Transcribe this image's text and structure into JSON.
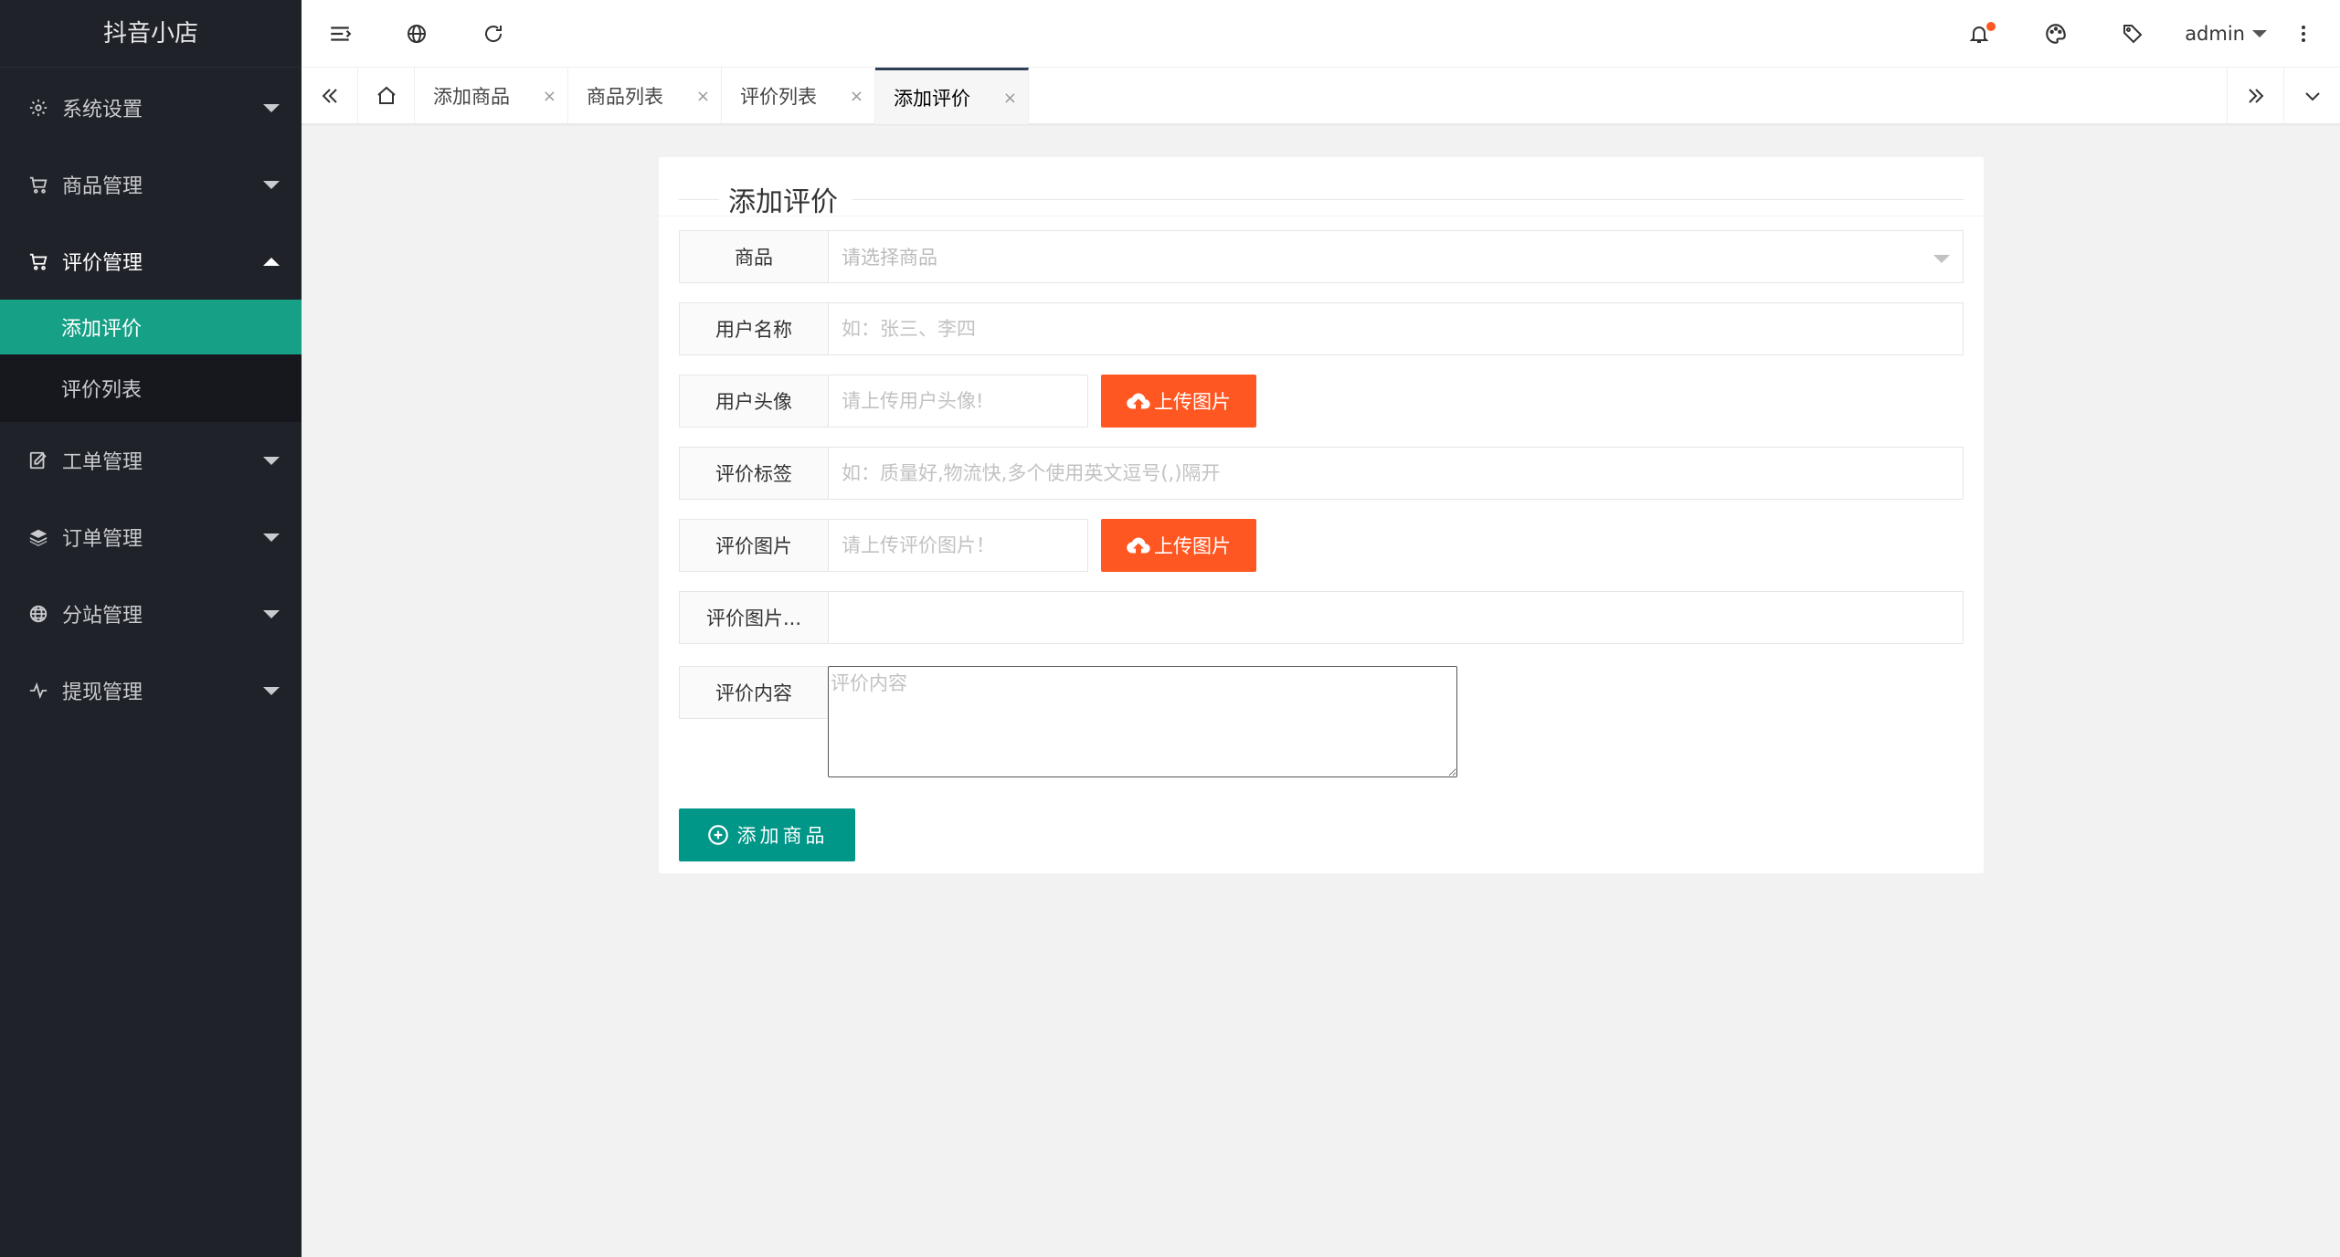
{
  "app": {
    "title": "抖音小店"
  },
  "sidebar": {
    "items": [
      {
        "label": "系统设置",
        "icon": "gear-icon"
      },
      {
        "label": "商品管理",
        "icon": "cart-icon"
      },
      {
        "label": "评价管理",
        "icon": "cart-icon",
        "open": true,
        "children": [
          {
            "label": "添加评价",
            "active": true
          },
          {
            "label": "评价列表"
          }
        ]
      },
      {
        "label": "工单管理",
        "icon": "edit-icon"
      },
      {
        "label": "订单管理",
        "icon": "layers-icon"
      },
      {
        "label": "分站管理",
        "icon": "globe-icon"
      },
      {
        "label": "提现管理",
        "icon": "pulse-icon"
      }
    ]
  },
  "header": {
    "user": "admin",
    "icons": [
      "menu-fold-icon",
      "globe-icon",
      "refresh-icon",
      "bell-icon",
      "theme-icon",
      "tag-icon",
      "more-icon"
    ],
    "accent": "#ff5722"
  },
  "tabs": {
    "items": [
      {
        "label": "添加商品"
      },
      {
        "label": "商品列表"
      },
      {
        "label": "评价列表"
      },
      {
        "label": "添加评价",
        "active": true
      }
    ],
    "close_glyph": "×"
  },
  "form": {
    "title": "添加评价",
    "fields": {
      "product": {
        "label": "商品",
        "placeholder": "请选择商品"
      },
      "username": {
        "label": "用户名称",
        "placeholder": "如：张三、李四"
      },
      "avatar": {
        "label": "用户头像",
        "placeholder": "请上传用户头像!",
        "button": "上传图片"
      },
      "tags": {
        "label": "评价标签",
        "placeholder": "如：质量好,物流快,多个使用英文逗号(,)隔开"
      },
      "images": {
        "label": "评价图片",
        "placeholder": "请上传评价图片！",
        "button": "上传图片"
      },
      "images_preview": {
        "label": "评价图片..."
      },
      "content": {
        "label": "评价内容",
        "placeholder": "评价内容"
      }
    },
    "submit": "添加商品"
  },
  "colors": {
    "sidebar_bg": "#20222a",
    "active_green": "#16a085",
    "upload_orange": "#ff5722",
    "submit_teal": "#009688"
  }
}
